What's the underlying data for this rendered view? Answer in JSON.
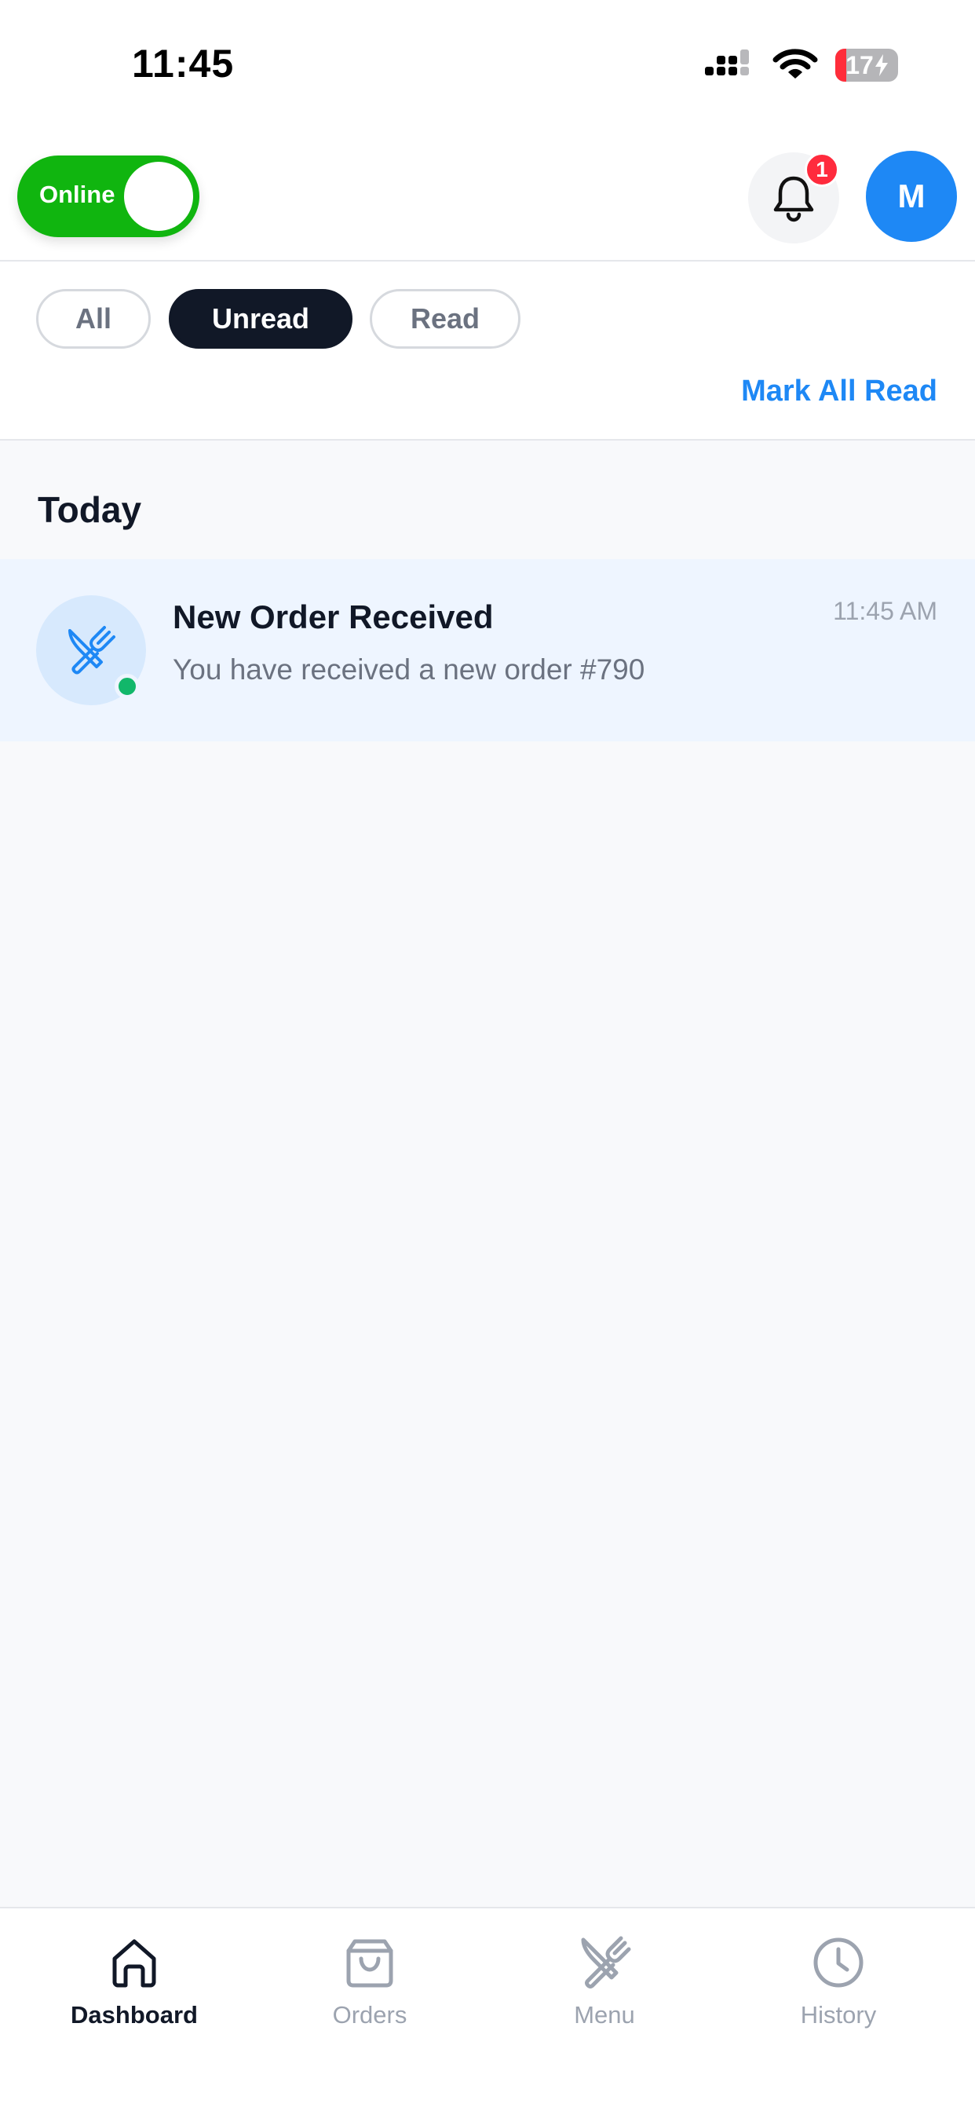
{
  "status_bar": {
    "time": "11:45",
    "battery": "17",
    "battery_color": "#ff2d3a"
  },
  "header": {
    "online_label": "Online",
    "online_color": "#10b50f",
    "bell_icon": "bell-icon",
    "notification_count": "1",
    "avatar_initial": "M",
    "avatar_color": "#1e88f5"
  },
  "filters": {
    "chips": [
      {
        "label": "All",
        "active": false
      },
      {
        "label": "Unread",
        "active": true
      },
      {
        "label": "Read",
        "active": false
      }
    ],
    "mark_all_read": "Mark All Read",
    "accent_color": "#1e88f5"
  },
  "notifications": {
    "section_title": "Today",
    "items": [
      {
        "icon": "utensils-icon",
        "title": "New Order Received",
        "body": "You have received a new order #790",
        "time": "11:45 AM",
        "unread": true
      }
    ]
  },
  "bottom_nav": {
    "items": [
      {
        "label": "Dashboard",
        "icon": "home-icon",
        "active": true
      },
      {
        "label": "Orders",
        "icon": "shopping-bag-icon",
        "active": false
      },
      {
        "label": "Menu",
        "icon": "utensils-icon",
        "active": false
      },
      {
        "label": "History",
        "icon": "clock-icon",
        "active": false
      }
    ]
  }
}
